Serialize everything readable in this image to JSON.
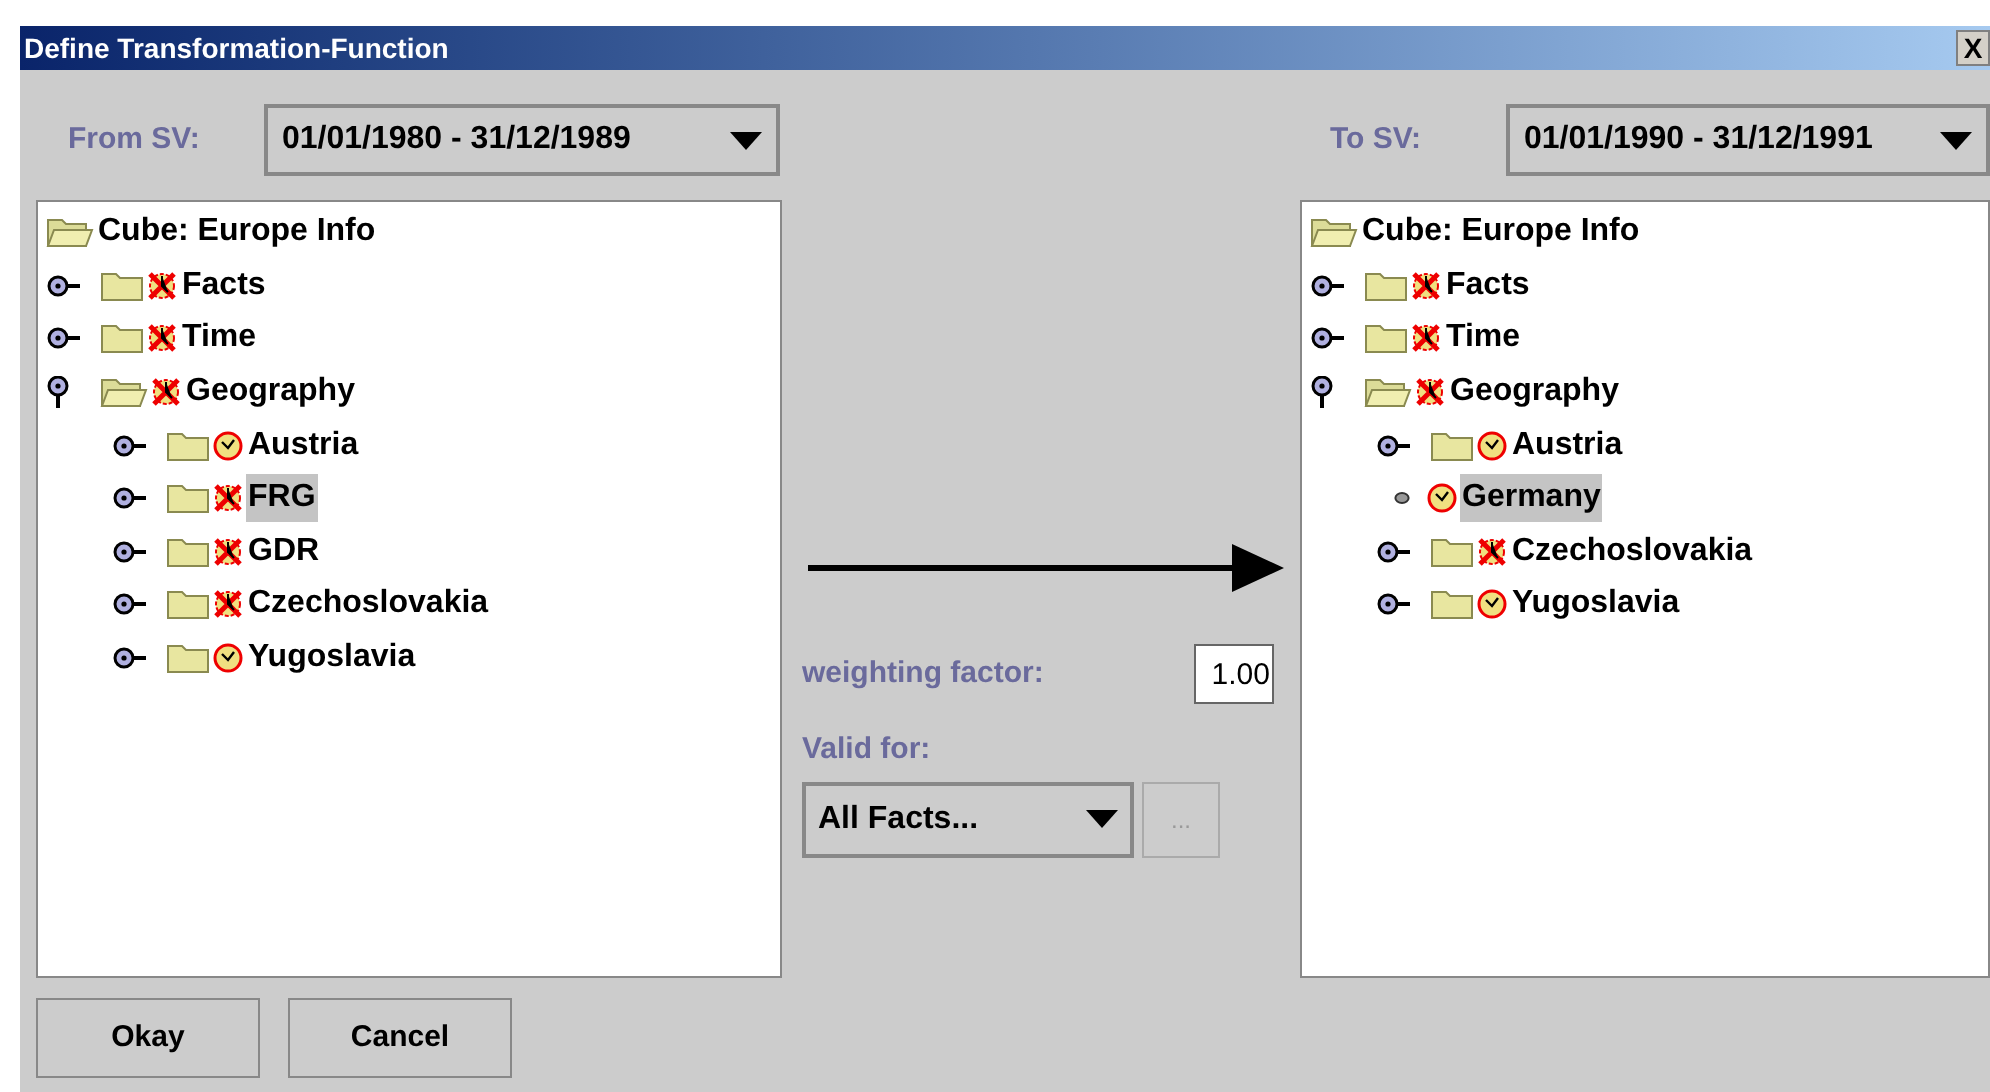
{
  "window": {
    "title": "Define Transformation-Function",
    "close": "X"
  },
  "from": {
    "label": "From SV:",
    "value": "01/01/1980 - 31/12/1989"
  },
  "to": {
    "label": "To SV:",
    "value": "01/01/1990 - 31/12/1991"
  },
  "from_tree": [
    {
      "label": "Cube: Europe Info",
      "kind": "cube",
      "children": [
        {
          "label": "Facts",
          "kind": "folder",
          "valid": false,
          "expanded": false,
          "selected": false
        },
        {
          "label": "Time",
          "kind": "folder",
          "valid": false,
          "expanded": false,
          "selected": false
        },
        {
          "label": "Geography",
          "kind": "folder",
          "valid": false,
          "expanded": true,
          "selected": false,
          "children": [
            {
              "label": "Austria",
              "kind": "folder",
              "valid": true,
              "expanded": false,
              "selected": false
            },
            {
              "label": "FRG",
              "kind": "folder",
              "valid": false,
              "expanded": false,
              "selected": true
            },
            {
              "label": "GDR",
              "kind": "folder",
              "valid": false,
              "expanded": false,
              "selected": false
            },
            {
              "label": "Czechoslovakia",
              "kind": "folder",
              "valid": false,
              "expanded": false,
              "selected": false
            },
            {
              "label": "Yugoslavia",
              "kind": "folder",
              "valid": true,
              "expanded": false,
              "selected": false
            }
          ]
        }
      ]
    }
  ],
  "to_tree": [
    {
      "label": "Cube: Europe Info",
      "kind": "cube",
      "children": [
        {
          "label": "Facts",
          "kind": "folder",
          "valid": false,
          "expanded": false,
          "selected": false
        },
        {
          "label": "Time",
          "kind": "folder",
          "valid": false,
          "expanded": false,
          "selected": false
        },
        {
          "label": "Geography",
          "kind": "folder",
          "valid": false,
          "expanded": true,
          "selected": false,
          "children": [
            {
              "label": "Austria",
              "kind": "folder",
              "valid": true,
              "expanded": false,
              "selected": false
            },
            {
              "label": "Germany",
              "kind": "leaf",
              "valid": true,
              "selected": true
            },
            {
              "label": "Czechoslovakia",
              "kind": "folder",
              "valid": false,
              "expanded": false,
              "selected": false
            },
            {
              "label": "Yugoslavia",
              "kind": "folder",
              "valid": true,
              "expanded": false,
              "selected": false
            }
          ]
        }
      ]
    }
  ],
  "weighting": {
    "label": "weighting factor:",
    "value": "1.00"
  },
  "valid_for": {
    "label": "Valid for:",
    "value": "All Facts...",
    "more": "..."
  },
  "buttons": [
    "Okay",
    "Cancel"
  ]
}
